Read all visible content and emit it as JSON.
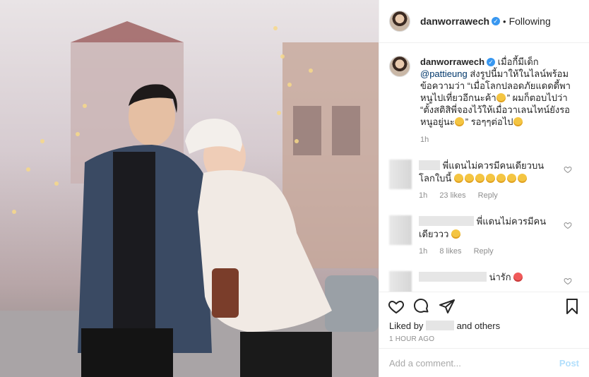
{
  "post": {
    "image_alt": "couple photo in a winter town with string lights",
    "username": "danworrawech",
    "follow_status": "Following",
    "caption": {
      "username": "danworrawech",
      "line1": "เมื่อกี้มีเด็ก",
      "mention": "@pattieung",
      "text_rest": " ส่งรูปนี้มาให้ในไลน์พร้อมข้อความว่า “เมื่อโลกปลอดภัยแดดดี้พาหนูไปเที่ยวอีกนะค้า",
      "text_rest2": "” ผมก็ตอบไปว่า “ตั้งสติสิพี่จองไว้ให้เมื่อวาเลนไทน์ยังรอหนูอยู่นะ",
      "text_end": "” รอๆๆต่อไป",
      "time": "1h"
    },
    "comments": [
      {
        "text": "พี่แดนไม่ควรมีคนเดียวบนโลกใบนี้",
        "time": "1h",
        "likes": "23 likes",
        "reply": "Reply"
      },
      {
        "text": "พี่แดนไม่ควรมีคนเดียววว",
        "time": "1h",
        "likes": "8 likes",
        "reply": "Reply"
      },
      {
        "text": "น่ารัก",
        "time": "",
        "likes": "",
        "reply": ""
      }
    ],
    "liked_prefix": "Liked by",
    "liked_suffix": "and others",
    "posted_ago": "1 HOUR AGO",
    "comment_placeholder": "Add a comment...",
    "post_button": "Post"
  },
  "colors": {
    "verified": "#3897f0",
    "link": "#00376b",
    "post_disabled": "#b2dffc"
  },
  "icons": [
    "verified-badge-icon",
    "heart-icon",
    "comment-icon",
    "share-icon",
    "bookmark-icon",
    "small-heart-icon"
  ]
}
